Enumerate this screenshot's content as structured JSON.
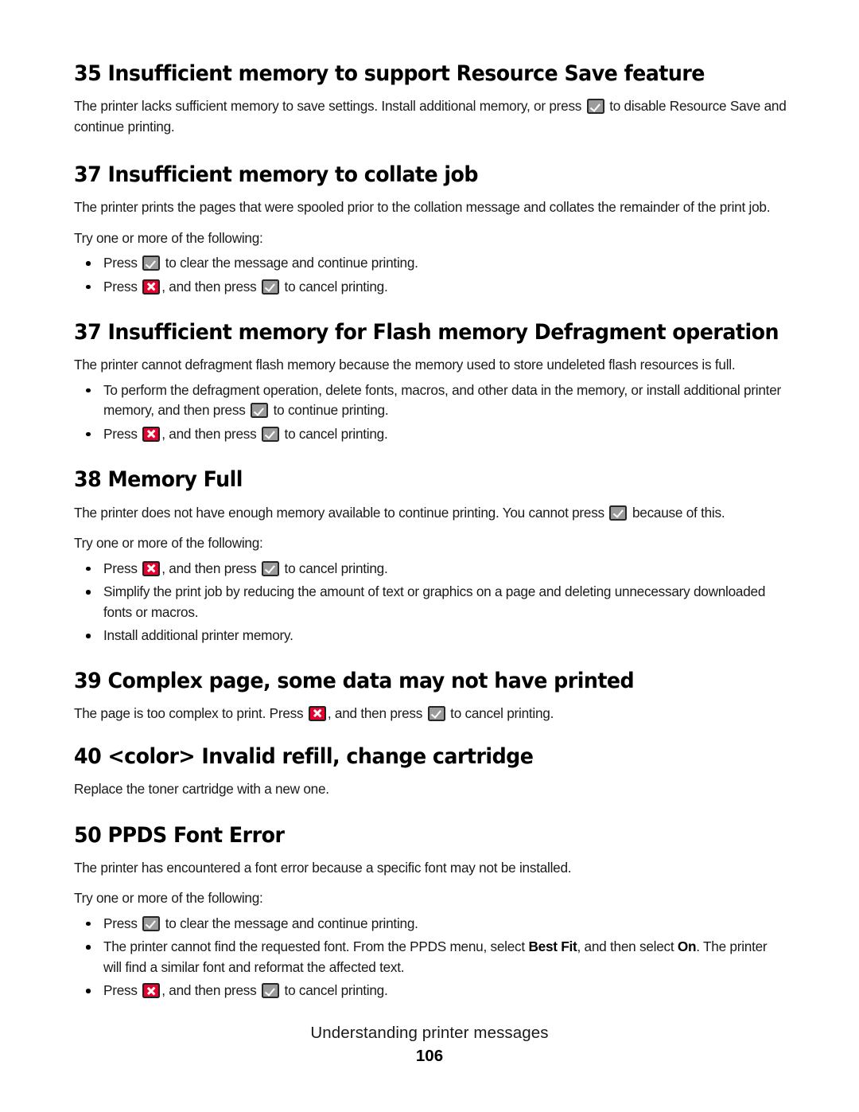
{
  "document": {
    "page_number": "106",
    "footer_title": "Understanding printer messages"
  },
  "icons": {
    "check_key": "check-key-icon",
    "x_key": "x-key-icon",
    "bullet": "bullet-dot-icon"
  },
  "colors": {
    "x_key_red": "#e4032e",
    "check_key_gray": "#9b9b9b",
    "key_border": "#262626",
    "text": "#1a1a1a",
    "heading": "#000000",
    "page_background": "#ffffff"
  },
  "sections": [
    {
      "heading": "35 Insufficient memory to support Resource Save feature",
      "paragraph_part1": "The printer lacks sufficient memory to save settings. Install additional memory, or press",
      "paragraph_part2": "to disable Resource Save and continue printing."
    },
    {
      "heading": "37 Insufficient memory to collate job",
      "paragraph": "The printer prints the pages that were spooled prior to the collation message and collates the remainder of the print job.",
      "intro": "Try one or more of the following:",
      "bullets": [
        {
          "part1": "Press",
          "part2": "to clear the message and continue printing."
        },
        {
          "part1": "Press",
          "part2": ", and then press",
          "part3": "to cancel printing."
        }
      ]
    },
    {
      "heading": "37 Insufficient memory for Flash memory Defragment operation",
      "paragraph": "The printer cannot defragment flash memory because the memory used to store undeleted flash resources is full.",
      "bullets": [
        {
          "part1": "To perform the defragment operation, delete fonts, macros, and other data in the memory, or install additional printer memory, and then press",
          "part2": "to continue printing."
        },
        {
          "part1": "Press",
          "part2": ", and then press",
          "part3": "to cancel printing."
        }
      ]
    },
    {
      "heading": "38 Memory Full",
      "paragraph_part1": "The printer does not have enough memory available to continue printing. You cannot press",
      "paragraph_part2": "because of this.",
      "intro": "Try one or more of the following:",
      "bullets": [
        {
          "part1": "Press",
          "part2": ", and then press",
          "part3": "to cancel printing."
        },
        {
          "text": "Simplify the print job by reducing the amount of text or graphics on a page and deleting unnecessary downloaded fonts or macros."
        },
        {
          "text": "Install additional printer memory."
        }
      ]
    },
    {
      "heading": "39 Complex page, some data may not have printed",
      "paragraph_part1": "The page is too complex to print. Press",
      "paragraph_part2": ", and then press",
      "paragraph_part3": "to cancel printing."
    },
    {
      "heading": "40 <color> Invalid refill, change cartridge",
      "paragraph": "Replace the toner cartridge with a new one."
    },
    {
      "heading": "50 PPDS Font Error",
      "paragraph": "The printer has encountered a font error because a specific font may not be installed.",
      "intro": "Try one or more of the following:",
      "bullets": [
        {
          "part1": "Press",
          "part2": "to clear the message and continue printing."
        },
        {
          "part1": "The printer cannot find the requested font. From the PPDS menu, select",
          "bold1": "Best Fit",
          "part2": ", and then select",
          "bold2": "On",
          "part3": ". The printer will find a similar font and reformat the affected text."
        },
        {
          "part1": "Press",
          "part2": ", and then press",
          "part3": "to cancel printing."
        }
      ]
    }
  ]
}
